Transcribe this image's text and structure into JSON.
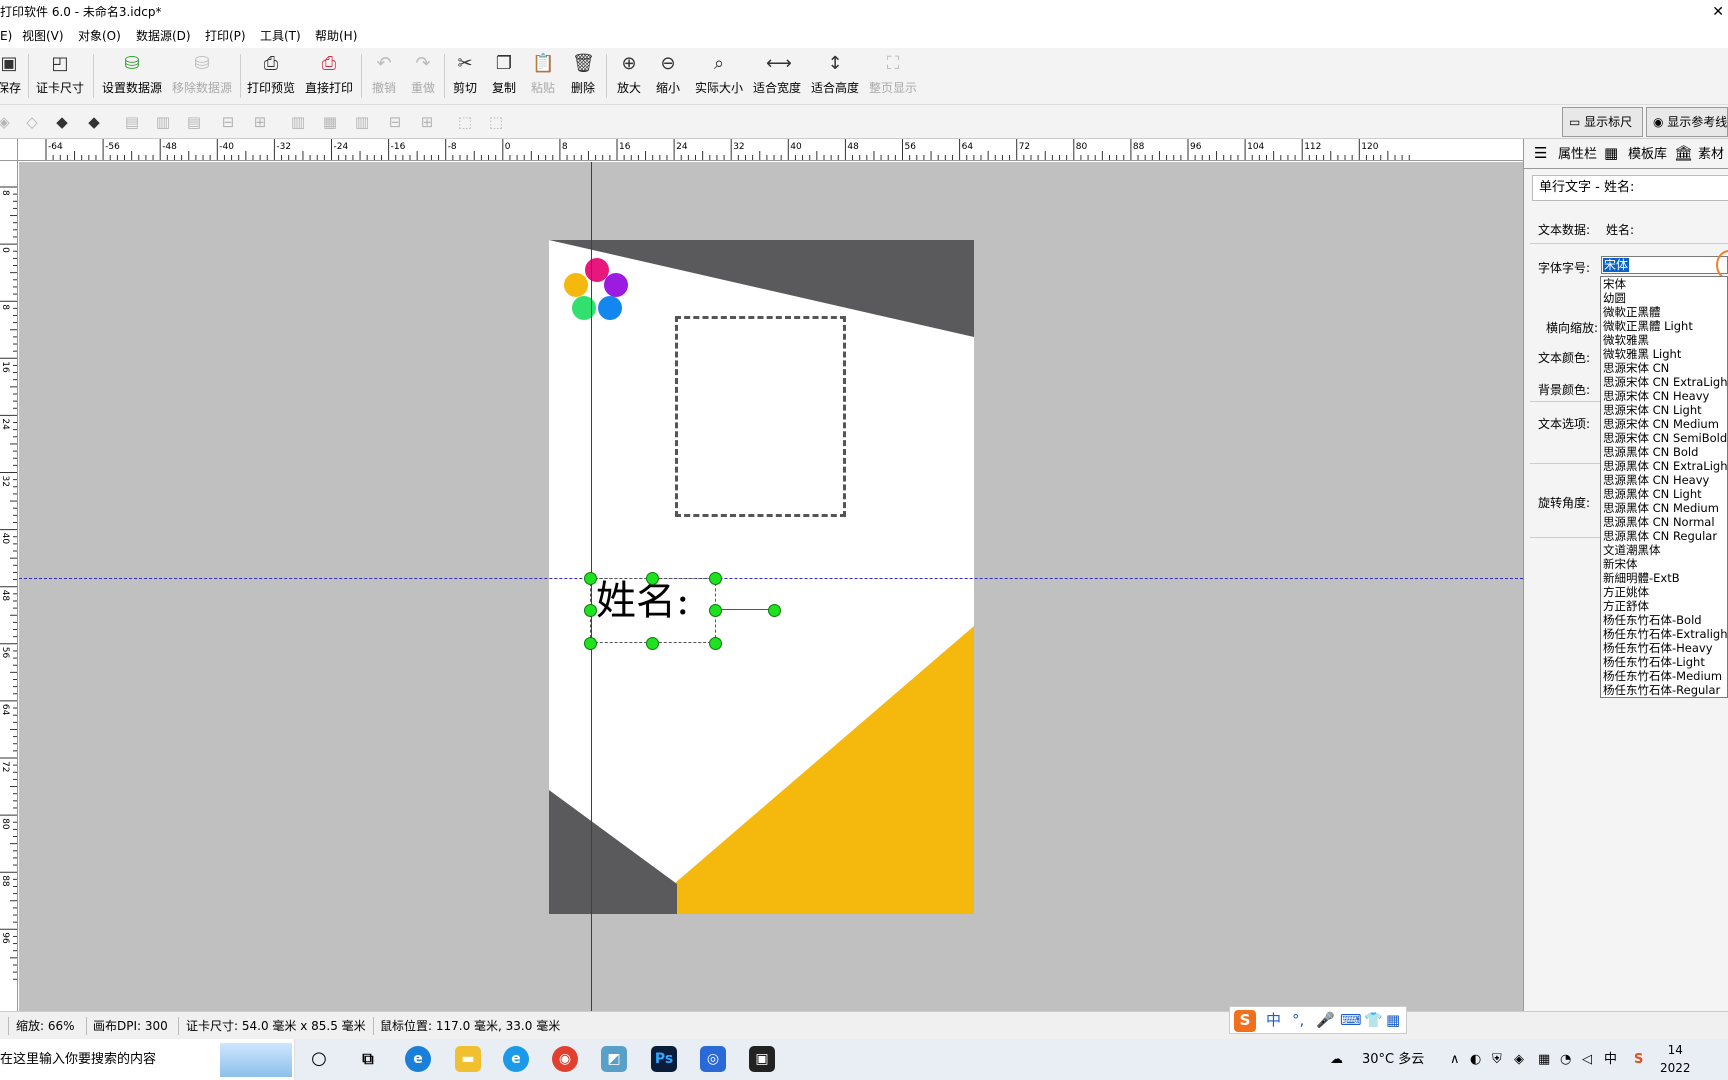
{
  "window": {
    "title": "打印软件 6.0 - 未命名3.idcp*"
  },
  "menu": {
    "file": "E)",
    "view": "视图(V)",
    "object": "对象(O)",
    "datasource": "数据源(D)",
    "print": "打印(P)",
    "tools": "工具(T)",
    "help": "帮助(H)"
  },
  "toolbar": {
    "save": "保存",
    "card_size": "证卡尺寸",
    "set_datasource": "设置数据源",
    "remove_datasource": "移除数据源",
    "print_preview": "打印预览",
    "direct_print": "直接打印",
    "undo": "撤销",
    "redo": "重做",
    "cut": "剪切",
    "copy": "复制",
    "paste": "粘贴",
    "delete": "删除",
    "zoom_in": "放大",
    "zoom_out": "缩小",
    "actual_size": "实际大小",
    "fit_width": "适合宽度",
    "fit_height": "适合高度",
    "full_page": "整页显示"
  },
  "toolbar2": {
    "show_ruler": "显示标尺",
    "show_guides": "显示参考线"
  },
  "ruler": {
    "h_ticks": [
      "-64",
      "-56",
      "-48",
      "-40",
      "-32",
      "-24",
      "-16",
      "-8",
      "0",
      "8",
      "16",
      "24",
      "32",
      "40",
      "48",
      "56",
      "64",
      "72",
      "80",
      "88",
      "96",
      "104",
      "112",
      "120"
    ],
    "v_ticks": [
      "8",
      "0",
      "8",
      "16",
      "24",
      "32",
      "40",
      "48",
      "56",
      "64",
      "72",
      "80",
      "88",
      "96"
    ]
  },
  "canvas": {
    "name_text": "姓名:"
  },
  "panel": {
    "tabs": [
      "属性栏",
      "模板库",
      "素材"
    ],
    "object_title": "单行文字 - 姓名:",
    "labels": {
      "text_data": "文本数据:",
      "font": "字体字号:",
      "h_scale": "横向缩放:",
      "text_color": "文本颜色:",
      "bg_color": "背景颜色:",
      "text_options": "文本选项:",
      "rotation": "旋转角度:"
    },
    "text_data_value": "姓名:",
    "font_value": "宋体"
  },
  "font_list": [
    "宋体",
    "幼圆",
    "微軟正黑體",
    "微軟正黑體 Light",
    "微软雅黑",
    "微软雅黑 Light",
    "思源宋体 CN",
    "思源宋体 CN ExtraLight",
    "思源宋体 CN Heavy",
    "思源宋体 CN Light",
    "思源宋体 CN Medium",
    "思源宋体 CN SemiBold",
    "思源黑体 CN Bold",
    "思源黑体 CN ExtraLight",
    "思源黑体 CN Heavy",
    "思源黑体 CN Light",
    "思源黑体 CN Medium",
    "思源黑体 CN Normal",
    "思源黑体 CN Regular",
    "文道潮黑体",
    "新宋体",
    "新細明體-ExtB",
    "方正姚体",
    "方正舒体",
    "杨任东竹石体-Bold",
    "杨任东竹石体-Extralight",
    "杨任东竹石体-Heavy",
    "杨任东竹石体-Light",
    "杨任东竹石体-Medium",
    "杨任东竹石体-Regular"
  ],
  "status": {
    "zoom": "缩放: 66%",
    "dpi": "画布DPI: 300",
    "card_size": "证卡尺寸: 54.0 毫米 x 85.5 毫米",
    "mouse_pos": "鼠标位置: 117.0 毫米, 33.0 毫米"
  },
  "ime": {
    "brand": "S",
    "lang": "中"
  },
  "taskbar": {
    "search_placeholder": "在这里输入你要搜索的内容",
    "weather": "30°C 多云",
    "ime_indicator": "中",
    "time": "14",
    "date": "2022"
  },
  "colors": {
    "accent_yellow": "#f5b80c",
    "dark_gray": "#5a595b",
    "handle_green": "#1ee21e",
    "guide_blue": "#3030c0",
    "dot_pink": "#e8177e",
    "dot_purple": "#9b1be0",
    "dot_yellow": "#f5b80c",
    "dot_green": "#32e070",
    "dot_blue": "#1486f0"
  },
  "icons": {
    "window_close": "close-icon"
  }
}
